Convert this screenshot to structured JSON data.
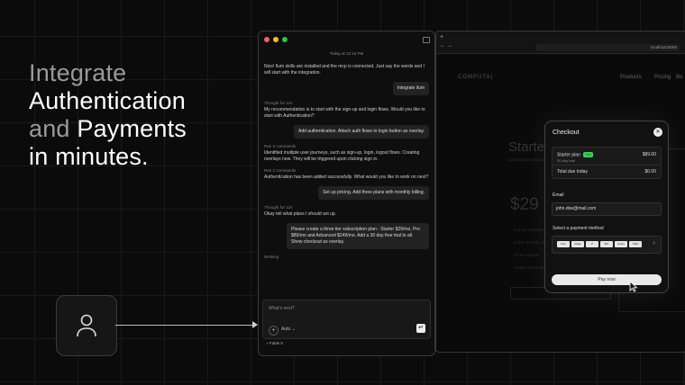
{
  "headline": {
    "line1": "Integrate",
    "line2": "Authentication",
    "line3_a": "and",
    "line3_b": "Payments",
    "line4": "in minutes."
  },
  "user_icon": "user-icon",
  "chat": {
    "timestamp": "Today at 12:15 PM",
    "messages": [
      {
        "role": "ai",
        "text": "Nice! Ilum skills are installed and the mcp is connected. Just say the words and I will start with the integration."
      },
      {
        "role": "user",
        "text": "Integrate ilum"
      },
      {
        "role": "label",
        "text": "Thought for 12s"
      },
      {
        "role": "ai",
        "text": "My recommendation is to start with the sign-up and login flows.  Would you like to start with Authentication?"
      },
      {
        "role": "user",
        "text": "Add authentication. Attach auth flows to login button as overlay."
      },
      {
        "role": "label",
        "text": "Ran 3 commands"
      },
      {
        "role": "ai",
        "text": "Identified multiple user journeys, such as sign-up, login, logout flows. Creating overlays now. They will be triggered upon clicking sign in."
      },
      {
        "role": "label",
        "text": "Ran 2 commands"
      },
      {
        "role": "ai",
        "text": "Authentication has been added successfully. What would you like to work on next?"
      },
      {
        "role": "user",
        "text": "Set up pricing. Add three plans with monthly billing."
      },
      {
        "role": "label",
        "text": "Thought for 12s"
      },
      {
        "role": "ai",
        "text": "Okay tell what plans I should set up."
      },
      {
        "role": "user",
        "text": "Please create a three tier subscription plan - Starter $29/mo, Pro $89/mo and Advanced $249/mo. Add a 30 day free trial to all. Show checkout as overlay."
      },
      {
        "role": "label",
        "text": "Working"
      }
    ],
    "input_placeholder": "What's next?",
    "mode_label": "Auto ⌄",
    "model_label": "+ Fable 5"
  },
  "browser": {
    "url": "localhost:5000",
    "site_logo": "COMPUTA|",
    "nav": [
      "Products",
      "Pricing",
      "Bo"
    ],
    "page_title": "Starter",
    "page_subtitle": "Lorem ipsum dolor sit amet",
    "page_price": "$29",
    "page_features": [
      "2 seats included",
      "5,000 monthly events",
      "Email support",
      "Hosted checkout"
    ],
    "page_button": "Start free trial"
  },
  "checkout": {
    "title": "Checkout",
    "plan": "Starter plan",
    "plan_badge": "Trial",
    "plan_trial": "30-day trial",
    "plan_amount": "$89.00",
    "due_label": "Total due today",
    "due_amount": "$0.00",
    "email_label": "Email",
    "email_value": "john.doe@mail.com",
    "payment_label": "Select a payment method",
    "payment_methods": [
      "Pay",
      "GPay",
      "P",
      "MC",
      "Amex",
      "VISA"
    ],
    "pay_button": "Pay now"
  },
  "colors": {
    "background": "#0b0b0b",
    "accent_green": "#3ccf5c",
    "traffic_red": "#ff5f57",
    "traffic_yellow": "#febc2e",
    "traffic_green": "#28c840"
  }
}
